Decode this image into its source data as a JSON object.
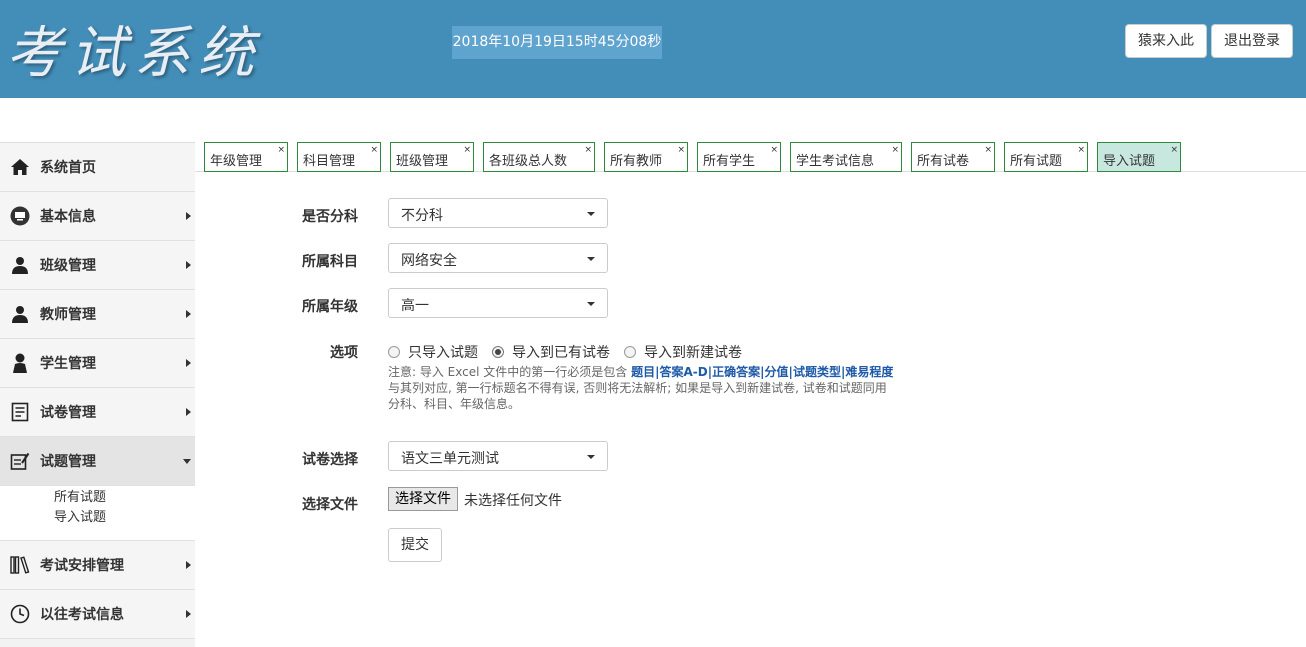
{
  "header": {
    "logo": "考试系统",
    "datetime": "2018年10月19日15时45分08秒",
    "enter_label": "猿来入此",
    "logout_label": "退出登录",
    "bg_color": "#438eb9"
  },
  "sidebar": {
    "items": [
      {
        "label": "系统首页",
        "icon": "home-icon"
      },
      {
        "label": "基本信息",
        "icon": "monitor-icon"
      },
      {
        "label": "班级管理",
        "icon": "user-icon"
      },
      {
        "label": "教师管理",
        "icon": "user-icon"
      },
      {
        "label": "学生管理",
        "icon": "user-icon"
      },
      {
        "label": "试卷管理",
        "icon": "document-icon"
      },
      {
        "label": "试题管理",
        "icon": "edit-icon"
      },
      {
        "label": "考试安排管理",
        "icon": "books-icon"
      },
      {
        "label": "以往考试信息",
        "icon": "clock-icon"
      }
    ],
    "submenu": [
      "所有试题",
      "导入试题"
    ]
  },
  "tabs": [
    {
      "label": "年级管理"
    },
    {
      "label": "科目管理"
    },
    {
      "label": "班级管理"
    },
    {
      "label": "各班级总人数"
    },
    {
      "label": "所有教师"
    },
    {
      "label": "所有学生"
    },
    {
      "label": "学生考试信息"
    },
    {
      "label": "所有试卷"
    },
    {
      "label": "所有试题"
    },
    {
      "label": "导入试题"
    }
  ],
  "tab_close": "×",
  "form": {
    "division_label": "是否分科",
    "division_value": "不分科",
    "subject_label": "所属科目",
    "subject_value": "网络安全",
    "grade_label": "所属年级",
    "grade_value": "高一",
    "options_label": "选项",
    "options": [
      "只导入试题",
      "导入到已有试卷",
      "导入到新建试卷"
    ],
    "note_prefix": "注意: 导入 Excel 文件中的第一行必须是包含 ",
    "note_fields": [
      "题目",
      "答案A-D",
      "正确答案",
      "分值",
      "试题类型",
      "难易程度"
    ],
    "note_separator": "|",
    "note_suffix": " 与其列对应, 第一行标题名不得有误, 否则将无法解析; 如果是导入到新建试卷, 试卷和试题同用 分科、科目、年级信息。",
    "paper_label": "试卷选择",
    "paper_value": "语文三单元测试",
    "file_label": "选择文件",
    "file_button": "选择文件",
    "file_status": "未选择任何文件",
    "submit_label": "提交"
  }
}
